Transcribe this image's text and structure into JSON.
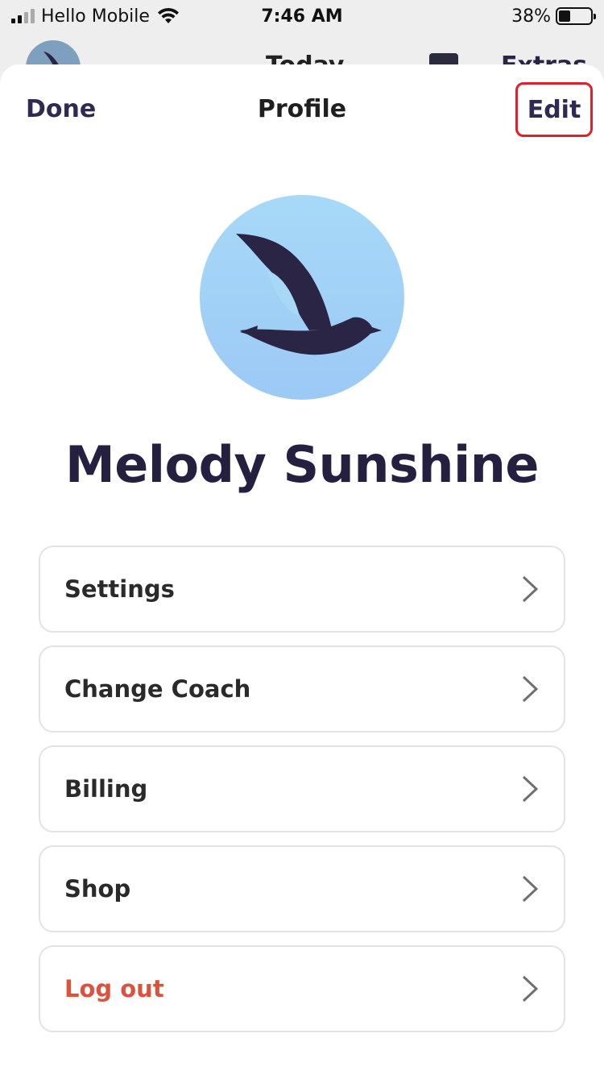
{
  "status_bar": {
    "carrier": "Hello Mobile",
    "time": "7:46 AM",
    "battery_percent": "38%",
    "battery_level": 0.38
  },
  "background_screen": {
    "title": "Today",
    "right_label": "Extras"
  },
  "nav": {
    "done_label": "Done",
    "title": "Profile",
    "edit_label": "Edit"
  },
  "profile": {
    "name": "Melody Sunshine",
    "avatar_icon": "bird-logo-icon"
  },
  "menu": {
    "items": [
      {
        "label": "Settings"
      },
      {
        "label": "Change Coach"
      },
      {
        "label": "Billing"
      },
      {
        "label": "Shop"
      },
      {
        "label": "Log out"
      }
    ]
  },
  "colors": {
    "accent": "#2f2a52",
    "name_text": "#25203f",
    "logout": "#d9533e",
    "highlight_border": "#e01f2b",
    "avatar_bg": "#a7d9f7"
  }
}
